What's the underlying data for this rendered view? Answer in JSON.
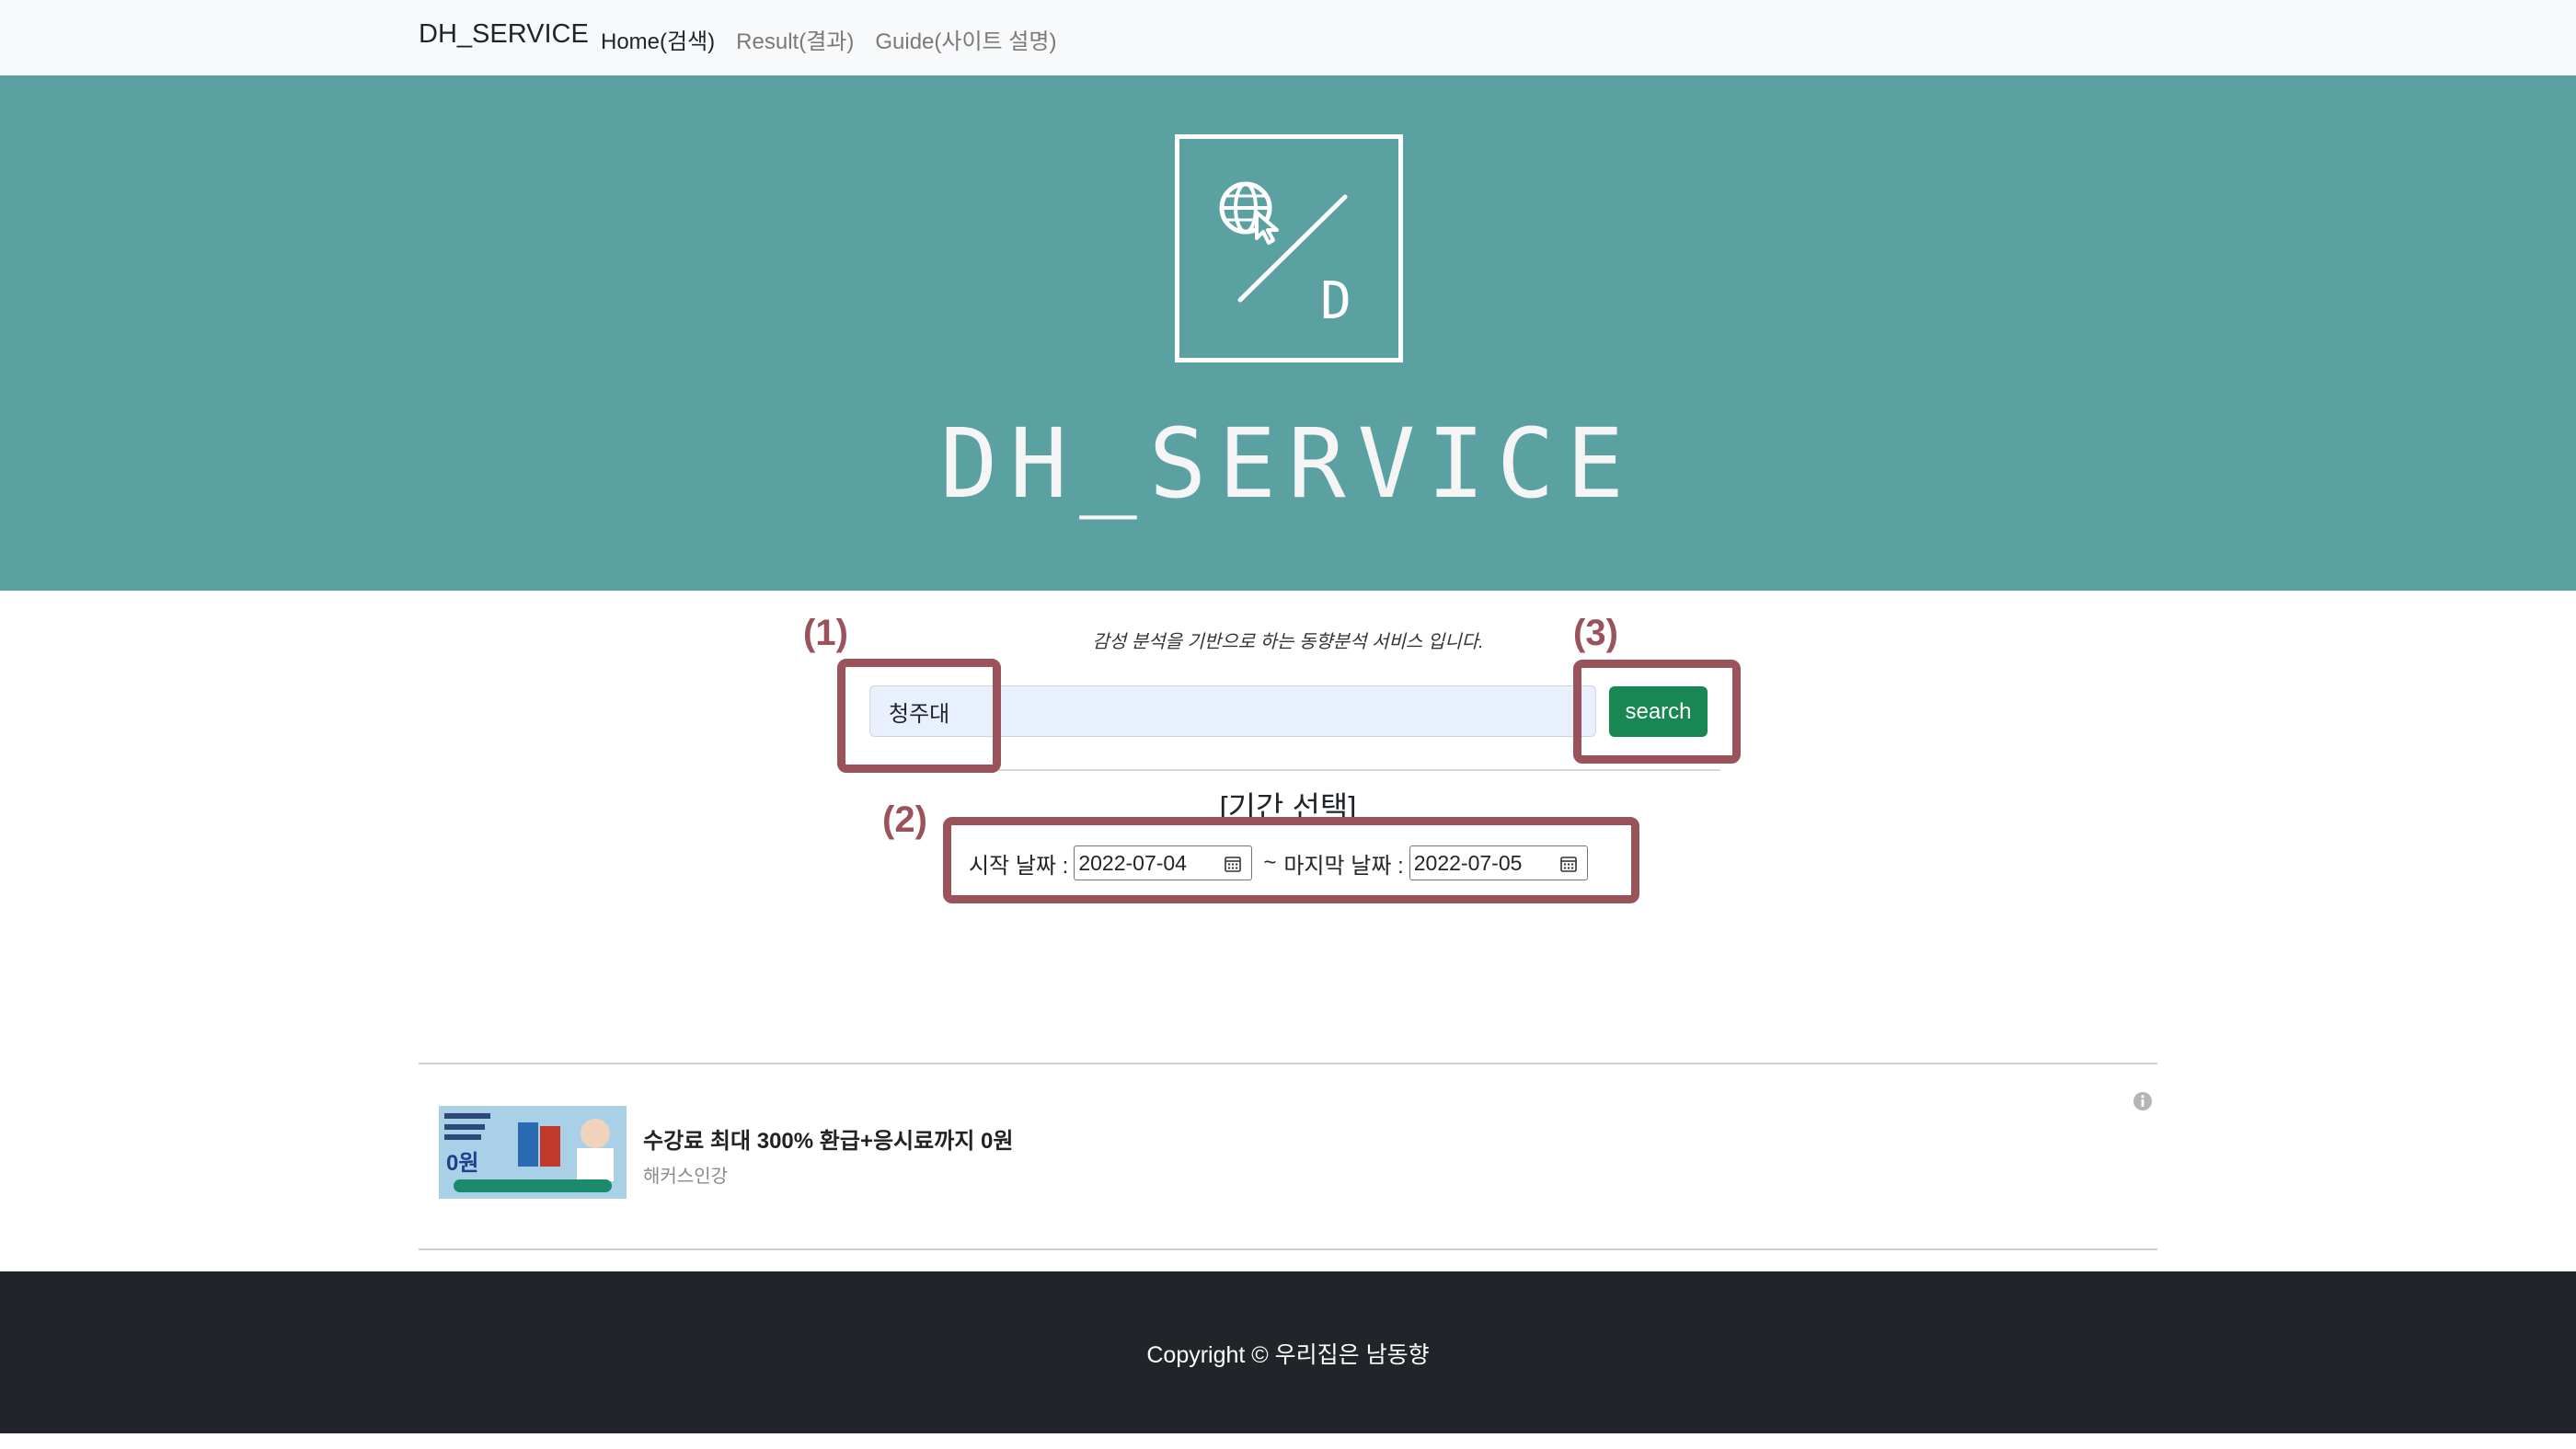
{
  "navbar": {
    "brand": "DH_SERVICE",
    "links": [
      {
        "label": "Home(검색)",
        "active": true
      },
      {
        "label": "Result(결과)",
        "active": false
      },
      {
        "label": "Guide(사이트 설명)",
        "active": false
      }
    ]
  },
  "hero": {
    "logo_letter": "D",
    "title": "DH_SERVICE",
    "background_color": "#5ba1a1"
  },
  "search": {
    "tagline": "감성 분석을 기반으로 하는 동향분석 서비스 입니다.",
    "query_value": "청주대",
    "button_label": "search",
    "button_color": "#198754"
  },
  "period": {
    "title": "[기간 선택]",
    "start_label": "시작 날짜 :",
    "start_value": "2022-07-04",
    "separator": "~",
    "end_label": "마지막 날짜 :",
    "end_value": "2022-07-05"
  },
  "annotations": {
    "color": "#9b535b",
    "labels": [
      "(1)",
      "(2)",
      "(3)"
    ]
  },
  "ad": {
    "title": "수강료 최대 300% 환급+응시료까지 0원",
    "source": "해커스인강",
    "image_text": "0원"
  },
  "footer": {
    "copyright": "Copyright © 우리집은 남동향"
  }
}
